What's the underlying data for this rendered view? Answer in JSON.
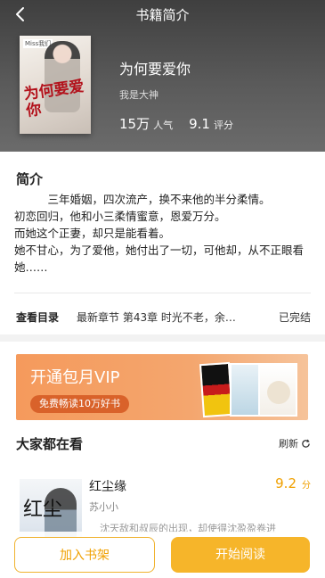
{
  "header": {
    "title": "书籍简介"
  },
  "book": {
    "cover_title": "为何要爱你",
    "cover_tag": "Miss我们",
    "title": "为何要爱你",
    "author": "我是大神",
    "popularity_value": "15万",
    "popularity_label": "人气",
    "score_value": "9.1",
    "score_label": "评分"
  },
  "intro": {
    "heading": "简介",
    "paragraphs": [
      "三年婚姻，四次流产，换不来他的半分柔情。",
      "初恋回归，他和小三柔情蜜意，恩爱万分。",
      "而她这个正妻，却只是能看着。",
      "她不甘心，为了爱他，她付出了一切，可他却，从不正眼看她……"
    ]
  },
  "toc": {
    "label": "查看目录",
    "latest": "最新章节 第43章  时光不老，余…",
    "status": "已完结"
  },
  "banner": {
    "title": "开通包月VIP",
    "subtitle": "免费畅读10万好书"
  },
  "recommend": {
    "heading": "大家都在看",
    "refresh_label": "刷新",
    "items": [
      {
        "title": "红尘缘",
        "author": "苏小小",
        "score": "9.2",
        "score_unit": "分",
        "desc": "沈天敌和叔辰的出现，却使得沈盈盈卷进",
        "cover_char": "红尘"
      }
    ]
  },
  "actions": {
    "add_shelf": "加入书架",
    "start_read": "开始阅读"
  },
  "colors": {
    "accent": "#f6b52a",
    "score": "#f0a000",
    "banner": "#f59a5c"
  }
}
